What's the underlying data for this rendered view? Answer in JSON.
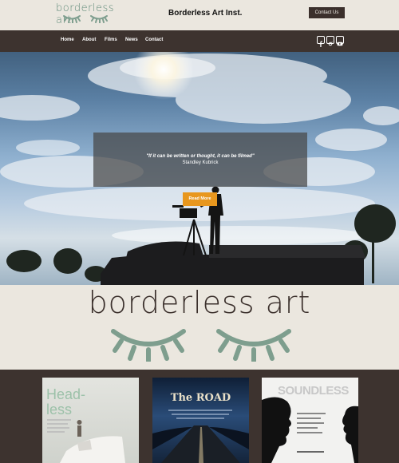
{
  "header": {
    "logo_text": "borderless art",
    "site_title": "Borderless Art Inst.",
    "contact_button": "Contact Us"
  },
  "nav": {
    "items": [
      "Home",
      "About",
      "Films",
      "News",
      "Contact"
    ]
  },
  "social": [
    "facebook-icon",
    "instagram-icon",
    "youtube-icon"
  ],
  "hero": {
    "quote": "\"If it can be written or thought, it can be filmed\"",
    "author": "Standley Kubrick",
    "read_more": "Read More"
  },
  "logo_section": {
    "word": "borderless art"
  },
  "films": [
    {
      "title": "Head-less"
    },
    {
      "title": "The ROAD"
    },
    {
      "title": "SOUNDLESS"
    }
  ],
  "colors": {
    "dark": "#3d332f",
    "cream": "#ebe7df",
    "accent": "#e8971e",
    "sage": "#7e9e8e"
  }
}
